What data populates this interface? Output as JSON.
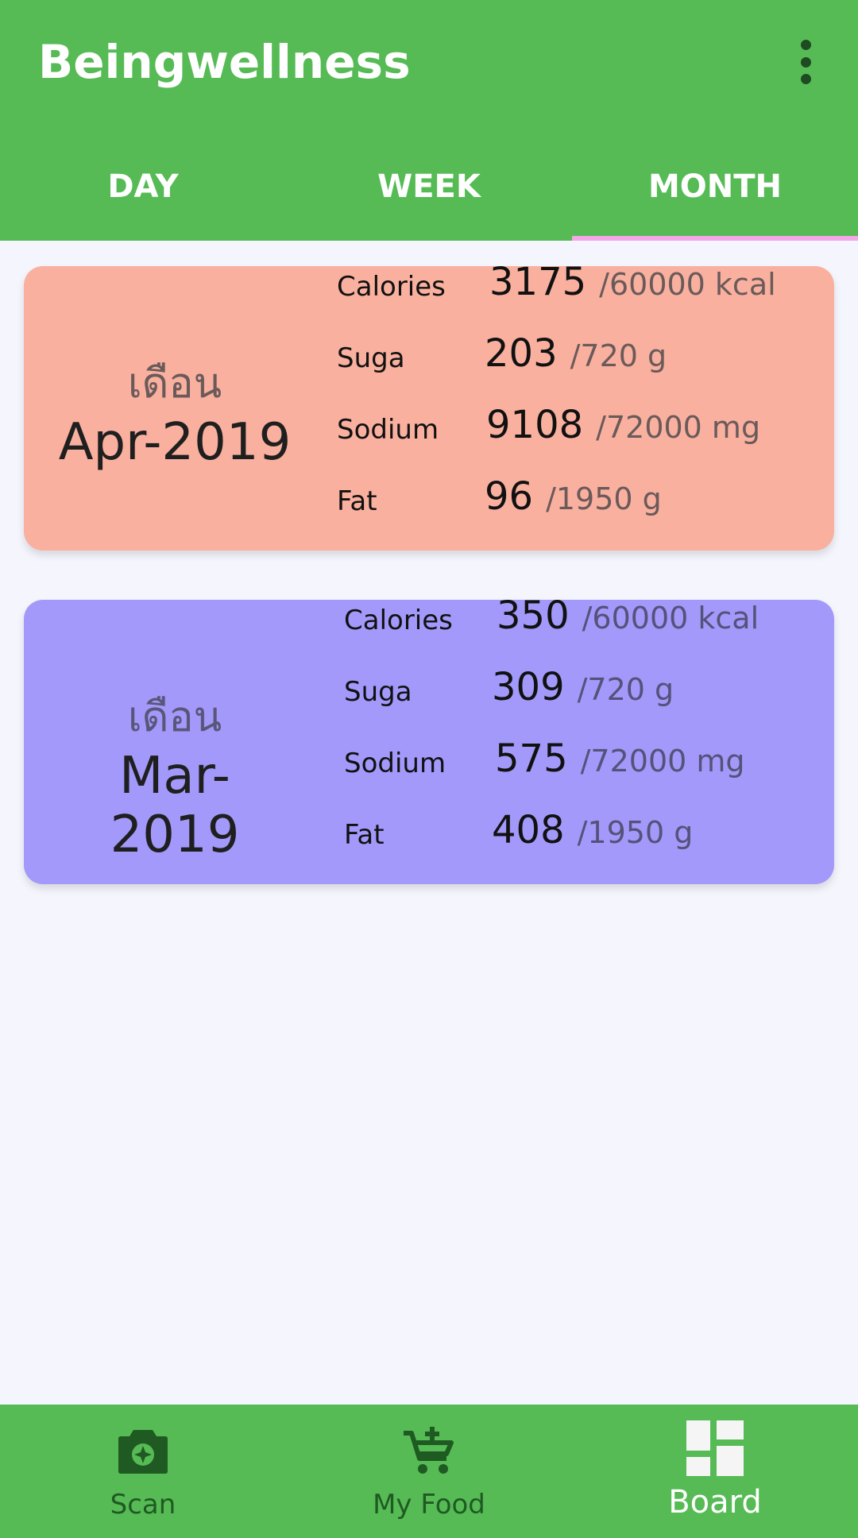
{
  "app": {
    "title": "Beingwellness"
  },
  "tabs": [
    {
      "label": "DAY"
    },
    {
      "label": "WEEK"
    },
    {
      "label": "MONTH",
      "selected": true
    }
  ],
  "months": [
    {
      "thai_label": "เดือน",
      "month": "Apr-2019",
      "color": "#f9b09f",
      "rows": [
        {
          "label": "Calories",
          "value": "3175",
          "goal": "/60000 kcal"
        },
        {
          "label": "Suga",
          "value": "203",
          "goal": "/720 g"
        },
        {
          "label": "Sodium",
          "value": "9108",
          "goal": "/72000 mg"
        },
        {
          "label": "Fat",
          "value": "96",
          "goal": "/1950 g"
        }
      ]
    },
    {
      "thai_label": "เดือน",
      "month": "Mar-2019",
      "color": "#a299fa",
      "rows": [
        {
          "label": "Calories",
          "value": "350",
          "goal": "/60000 kcal"
        },
        {
          "label": "Suga",
          "value": "309",
          "goal": "/720 g"
        },
        {
          "label": "Sodium",
          "value": "575",
          "goal": "/72000 mg"
        },
        {
          "label": "Fat",
          "value": "408",
          "goal": "/1950 g"
        }
      ]
    }
  ],
  "bottom_nav": [
    {
      "label": "Scan",
      "icon": "camera-icon"
    },
    {
      "label": "My Food",
      "icon": "add-cart-icon"
    },
    {
      "label": "Board",
      "icon": "dashboard-icon",
      "selected": true
    }
  ],
  "colors": {
    "primary": "#56bb55",
    "tab_indicator": "#f4a6e8",
    "background": "#f5f6fd"
  }
}
